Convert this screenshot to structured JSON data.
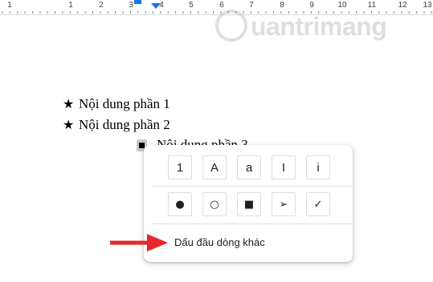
{
  "ruler": {
    "numbers": [
      "1",
      "1",
      "2",
      "3",
      "4",
      "5",
      "6",
      "7",
      "8",
      "9",
      "10",
      "11",
      "12",
      "13"
    ]
  },
  "watermark": {
    "text": "uantrimang",
    "icon": "quantrimang-logo-icon"
  },
  "document": {
    "list_items": [
      {
        "bullet": "★",
        "text": "Nội dung phần 1"
      },
      {
        "bullet": "★",
        "text": "Nội dung phần 2"
      },
      {
        "bullet": "",
        "text": "Nội dung phần 3"
      }
    ]
  },
  "bullet_menu": {
    "numbered_options": [
      "1",
      "A",
      "a",
      "I",
      "i"
    ],
    "bullet_options": [
      "●",
      "○",
      "■",
      "➢",
      "✓"
    ],
    "more_bullets_label": "Dấu đầu dòng khác"
  },
  "annotation": {
    "arrow_color": "#e8262b"
  },
  "colors": {
    "accent": "#1a73e8",
    "border": "#dadce0"
  }
}
